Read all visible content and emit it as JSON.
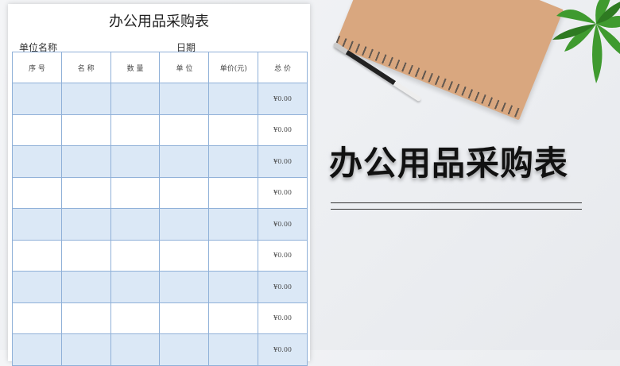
{
  "sheet": {
    "title": "办公用品采购表",
    "unit_label": "单位名称",
    "date_label": "日期",
    "headers": [
      "序 号",
      "名 称",
      "数 量",
      "单 位",
      "单价(元)",
      "总 价"
    ],
    "rows": [
      {
        "style": "blue",
        "total": "¥0.00"
      },
      {
        "style": "white",
        "total": "¥0.00"
      },
      {
        "style": "blue",
        "total": "¥0.00"
      },
      {
        "style": "white",
        "total": "¥0.00"
      },
      {
        "style": "blue",
        "total": "¥0.00"
      },
      {
        "style": "white",
        "total": "¥0.00"
      },
      {
        "style": "blue",
        "total": "¥0.00"
      },
      {
        "style": "white",
        "total": "¥0.00"
      },
      {
        "style": "blue",
        "total": "¥0.00"
      }
    ]
  },
  "banner": {
    "title": "办公用品采购表"
  },
  "colors": {
    "table_border": "#8fb0d8",
    "row_blue": "#dbe8f6",
    "notebook": "#d9a77f",
    "plant": "#3f9a2f"
  },
  "decorations": [
    "spiral-notebook",
    "pen",
    "potted-plant"
  ]
}
